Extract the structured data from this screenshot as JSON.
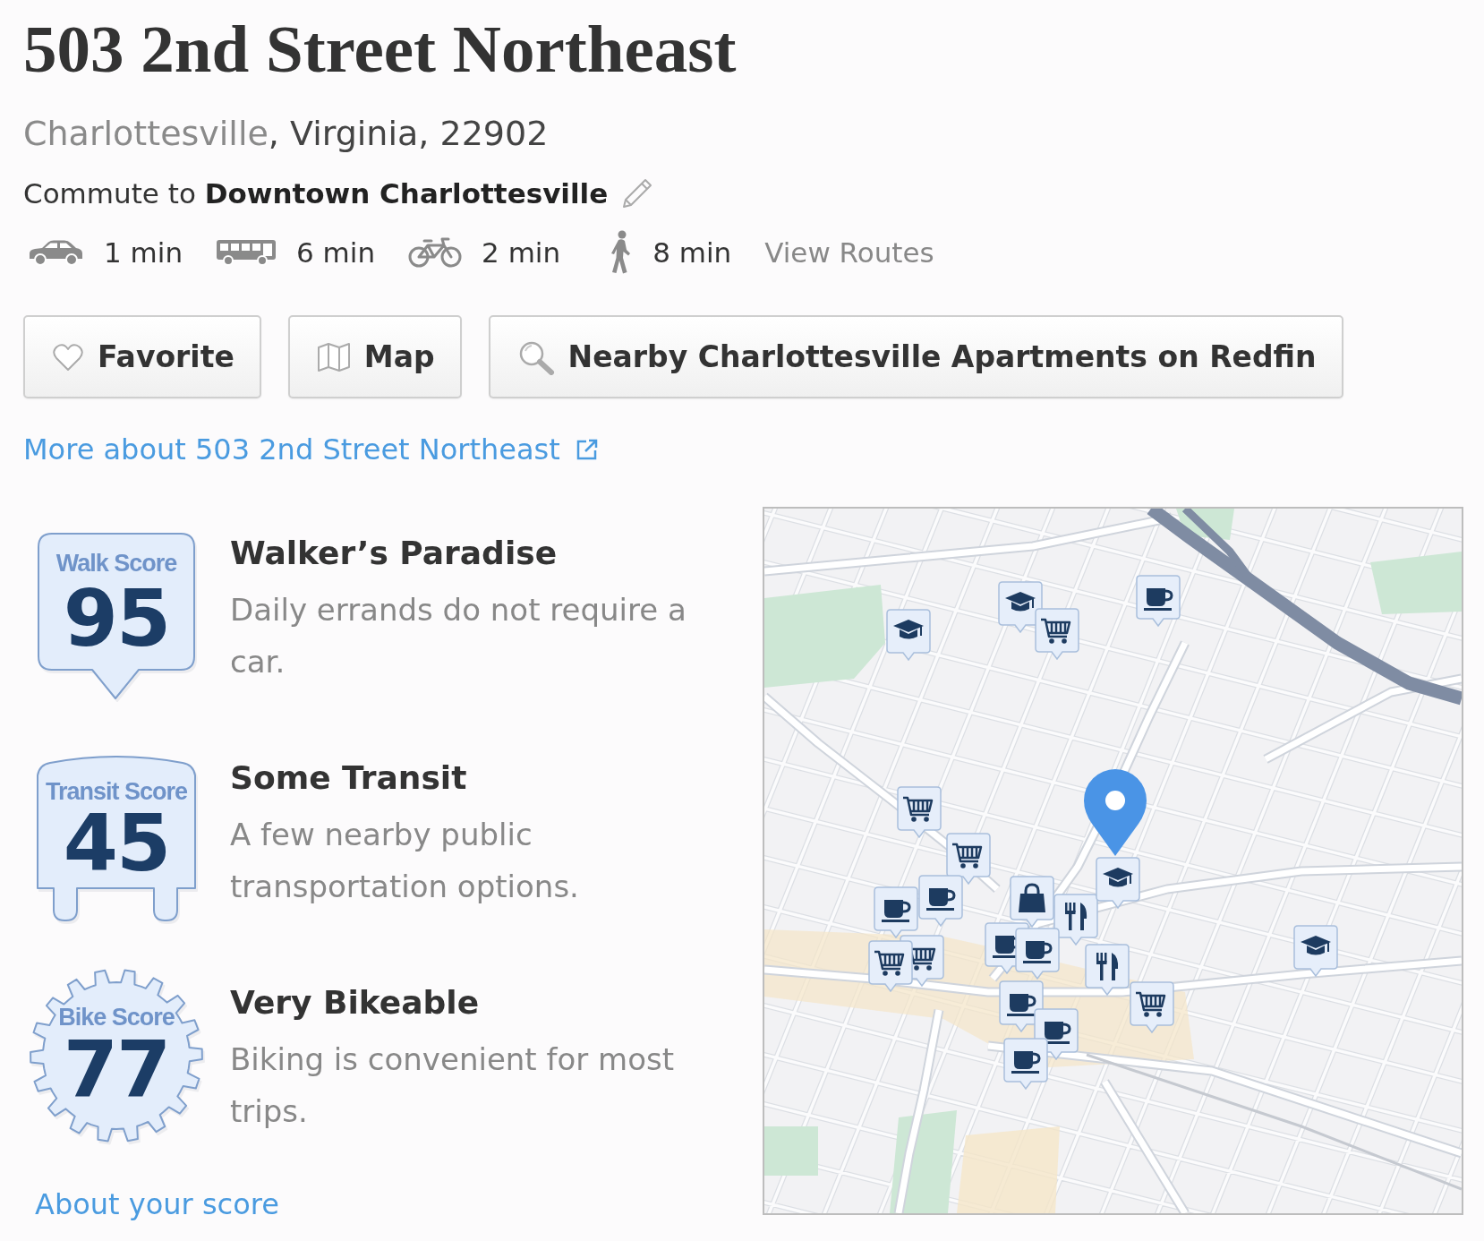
{
  "title": "503 2nd Street Northeast",
  "address": {
    "city": "Charlottesville",
    "rest": ", Virginia, 22902"
  },
  "commute": "Commute to **Downtown Charlottesville**",
  "travel_times": [
    {
      "kind": "car",
      "time": "1 min"
    },
    {
      "kind": "bus",
      "time": "6 min"
    },
    {
      "kind": "bike",
      "time": "2 min"
    },
    {
      "kind": "walk",
      "time": "8 min"
    }
  ],
  "view_routes": "View Routes",
  "buttons": [
    {
      "kind": "favorite",
      "label": "Favorite"
    },
    {
      "kind": "map",
      "label": "Map"
    },
    {
      "kind": "search",
      "label": "Nearby Charlottesville Apartments on Redfin"
    }
  ],
  "more_link": "More about 503 2nd Street Northeast",
  "scores": [
    {
      "kind": "walk",
      "label": "Walk Score",
      "value": "95",
      "heading": "Walker’s Paradise",
      "description": "Daily errands do not require a car."
    },
    {
      "kind": "transit",
      "label": "Transit Score",
      "value": "45",
      "heading": "Some Transit",
      "description": "A few nearby public transportation options."
    },
    {
      "kind": "bike",
      "label": "Bike Score",
      "value": "77",
      "heading": "Very Bikeable",
      "description": "Biking is convenient for most trips."
    }
  ],
  "about_link": "About your score"
}
